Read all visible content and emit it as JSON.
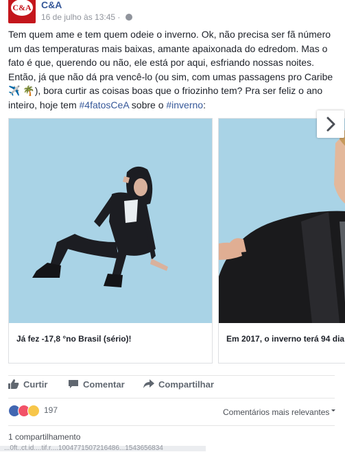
{
  "post": {
    "page_name": "C&A",
    "avatar_text": "C&A",
    "timestamp": "16 de julho às 13:45 ·",
    "text_lines": [
      "Tem quem ame e tem quem odeie o inverno. Ok, não precisa ser fã número",
      "um das temperaturas mais baixas, amante apaixonada do edredom. Mas o",
      "fato é que, querendo ou não, ele está por aqui, esfriando nossas noites.",
      "Então, já que não dá pra vencê-lo (ou sim, com umas passagens pro Caribe",
      "✈️ 🌴), bora curtir as coisas boas que o friozinho tem? Pra ser feliz o ano"
    ],
    "last_line_prefix": "inteiro, hoje tem ",
    "hashtag1": "#4fatosCeA",
    "last_line_mid": " sobre o ",
    "hashtag2": "#inverno",
    "last_line_suffix": ":"
  },
  "carousel": {
    "cards": [
      {
        "caption": "Já fez -17,8 °no Brasil (sério)!"
      },
      {
        "caption": "Em 2017, o inverno terá 94 dia"
      }
    ],
    "next_icon": "chevron-right-icon"
  },
  "actions": {
    "like_label": "Curtir",
    "comment_label": "Comentar",
    "share_label": "Compartilhar"
  },
  "reactions": {
    "count": "197",
    "sort_label": "Comentários mais relevantes"
  },
  "shares": {
    "label": "1 compartilhamento"
  },
  "status_bar": {
    "text": "...0ft..ct.id....tif.r....1004771507216486...1543656834"
  },
  "colors": {
    "brand_red": "#c4161c",
    "link_blue": "#365899",
    "photo_bg": "#a9d3e6"
  }
}
